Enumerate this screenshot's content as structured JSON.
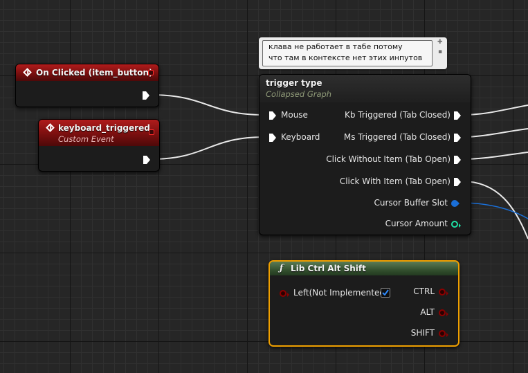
{
  "comment": {
    "lines": [
      "клава не работает в табе потому",
      "что там в контексте нет этих инпутов"
    ]
  },
  "on_clicked_node": {
    "title": "On Clicked (item_button)"
  },
  "keyboard_node": {
    "title": "keyboard_triggered",
    "subtitle": "Custom Event"
  },
  "collapsed_node": {
    "title": "trigger type",
    "subtitle": "Collapsed Graph",
    "inputs": [
      "Mouse",
      "Keyboard"
    ],
    "exec_outputs": [
      "Kb Triggered (Tab Closed)",
      "Ms Triggered (Tab Closed)",
      "Click Without Item (Tab Open)",
      "Click With Item (Tab Open)"
    ],
    "data_outputs": [
      "Cursor Buffer Slot",
      "Cursor Amount"
    ]
  },
  "lib_node": {
    "title": "Lib Ctrl Alt Shift",
    "input_label": "Left(Not Implemented)",
    "input_checked": true,
    "outputs": [
      "CTRL",
      "ALT",
      "SHIFT"
    ]
  },
  "colors": {
    "event_header": "#9a1818",
    "function_header": "#3e5c39",
    "selection_outline": "#f0a000",
    "bool_pin": "#8c0000",
    "object_pin": "#1a6fd8",
    "int_pin": "#1fe3a6",
    "exec_pin": "#ffffff"
  }
}
